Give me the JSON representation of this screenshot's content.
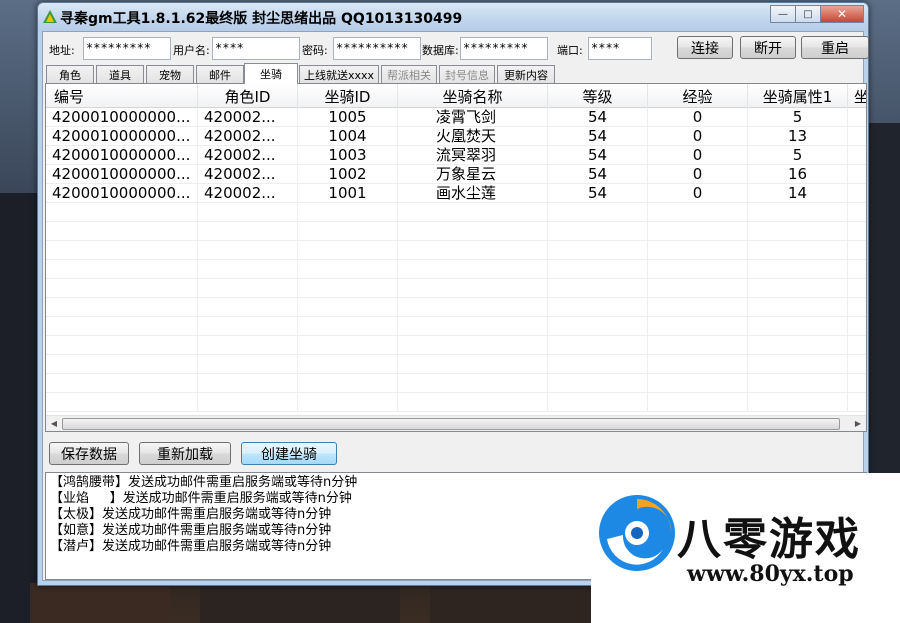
{
  "window": {
    "title": "寻秦gm工具1.8.1.62最终版 封尘思绪出品 QQ1013130499",
    "minimize_glyph": "—",
    "maximize_glyph": "□",
    "close_glyph": "✕"
  },
  "connection": {
    "address_label": "地址:",
    "address_value": "*********",
    "username_label": "用户名:",
    "username_value": "****",
    "password_label": "密码:",
    "password_value": "**********",
    "database_label": "数据库:",
    "database_value": "*********",
    "port_label": "端口:",
    "port_value": "****",
    "connect_label": "连接",
    "disconnect_label": "断开",
    "restart_label": "重启"
  },
  "tabs": [
    {
      "label": "角色"
    },
    {
      "label": "道具"
    },
    {
      "label": "宠物"
    },
    {
      "label": "邮件"
    },
    {
      "label": "坐骑"
    },
    {
      "label": "上线就送xxxx"
    },
    {
      "label": "帮派相关"
    },
    {
      "label": "封号信息"
    },
    {
      "label": "更新内容"
    }
  ],
  "grid": {
    "columns": [
      "编号",
      "角色ID",
      "坐骑ID",
      "坐骑名称",
      "等级",
      "经验",
      "坐骑属性1",
      "坐"
    ],
    "rows": [
      [
        "4200010000000...",
        "420002...",
        "1005",
        "凌霄飞剑",
        "54",
        "0",
        "5"
      ],
      [
        "4200010000000...",
        "420002...",
        "1004",
        "火凰焚天",
        "54",
        "0",
        "13"
      ],
      [
        "4200010000000...",
        "420002...",
        "1003",
        "流冥翠羽",
        "54",
        "0",
        "5"
      ],
      [
        "4200010000000...",
        "420002...",
        "1002",
        "万象星云",
        "54",
        "0",
        "16"
      ],
      [
        "4200010000000...",
        "420002...",
        "1001",
        "画水尘莲",
        "54",
        "0",
        "14"
      ]
    ],
    "scroll_left_glyph": "◀",
    "scroll_right_glyph": "▶"
  },
  "actions": {
    "save_label": "保存数据",
    "reload_label": "重新加载",
    "create_label": "创建坐骑"
  },
  "log": [
    "【鸿鹄腰带】发送成功邮件需重启服务端或等待n分钟",
    "【业焰     】发送成功邮件需重启服务端或等待n分钟",
    "【太极】发送成功邮件需重启服务端或等待n分钟",
    "【如意】发送成功邮件需重启服务端或等待n分钟",
    "【潜卢】发送成功邮件需重启服务端或等待n分钟"
  ],
  "watermark": {
    "name": "八零游戏",
    "url": "www.80yx.top"
  },
  "colors": {
    "title_bar": "#c4d8ee",
    "selected_button": "#bee6fd",
    "logo_blue": "#1e88e5",
    "logo_orange": "#f7a21b"
  }
}
